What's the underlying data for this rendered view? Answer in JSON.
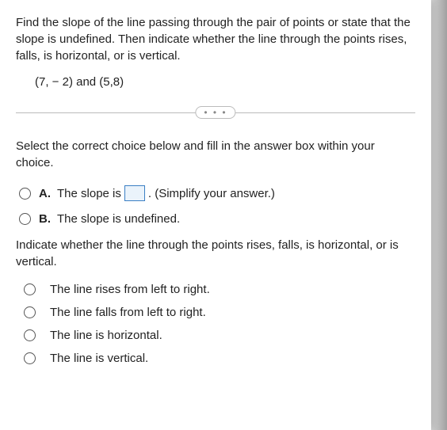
{
  "question": {
    "prompt": "Find the slope of the line passing through the pair of points or state that the slope is undefined. Then indicate whether the line through the points rises, falls, is horizontal, or is vertical.",
    "points": "(7, − 2) and (5,8)"
  },
  "ellipsis": "• • •",
  "part1": {
    "instruction": "Select the correct choice below and fill in the answer box within your choice.",
    "choiceA": {
      "letter": "A.",
      "before": "The slope is",
      "after": ". (Simplify your answer.)"
    },
    "choiceB": {
      "letter": "B.",
      "text": "The slope is undefined."
    }
  },
  "part2": {
    "instruction": "Indicate whether the line through the points rises, falls, is horizontal, or is vertical.",
    "options": [
      "The line rises from left to right.",
      "The line falls from left to right.",
      "The line is horizontal.",
      "The line is vertical."
    ]
  }
}
